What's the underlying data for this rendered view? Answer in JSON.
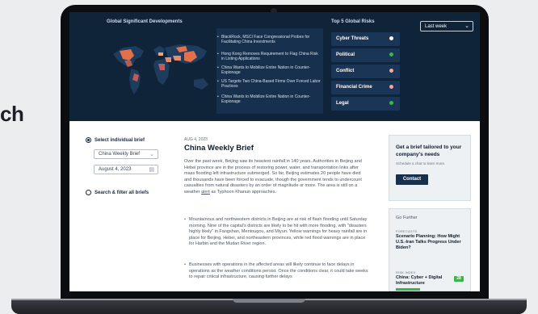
{
  "background_text": "ch",
  "header": {
    "developments_title": "Global Significant Developments",
    "risks_title": "Top 5 Global Risks",
    "period_select": "Last week"
  },
  "news": [
    "BlackRock, MSCI Face Congressional Probes for Facilitating China Investments",
    "Hong Kong Removes Requirement to Flag China Risk in Listing Applications",
    "China Wants to Mobilize Entire Nation in Counter-Espionage",
    "US Targets Two China-Based Firms Over Forced Labor Practices",
    "China Wants to Mobilize Entire Nation in Counter-Espionage"
  ],
  "risks": [
    {
      "label": "Cyber Threats",
      "icon": "plus-icon",
      "color": "#ffffff"
    },
    {
      "label": "Political",
      "icon": "plus-icon",
      "color": "#3bb54a"
    },
    {
      "label": "Conflict",
      "icon": "plus-icon",
      "color": "#f4a6a6"
    },
    {
      "label": "Financial Crime",
      "icon": "plus-icon",
      "color": "#f4a6a6"
    },
    {
      "label": "Legal",
      "icon": "plus-icon",
      "color": "#3bb54a"
    }
  ],
  "filters": {
    "select_individual_label": "Select individual brief",
    "brief_select": "China Weekly Brief",
    "date_field": "August 4, 2023",
    "search_filter_label": "Search & filter all briefs"
  },
  "article": {
    "date": "AUG 4, 2023",
    "title": "China Weekly Brief",
    "paragraph_before": "Over the past week, Beijing saw its heaviest rainfall in 140 years. Authorities in Beijing and Hebei province are in the process of restoring power, water, and transportation links after mass flooding left infrastructure submerged. So far, Beijing estimates 20 people have died and thousands have been forced to evacuate, though the government tends to undercount casualties from natural disasters by an order of magnitude or more. The area is still on a weather ",
    "paragraph_link": "alert",
    "paragraph_after": " as Typhoon Khanun approaches.",
    "bullet1": "Mountainous and northwestern districts in Beijing are at risk of flash flooding until Saturday morning. Nine of the capital's districts are likely to be hit with more flooding, with \"disasters highly likely\" in Fangshan, Mentougou, and Miyun. Yellow warnings for heavy rainfall are in place for Beijing, Hebei, and northeastern provinces, while red flood warnings are in place for Harbin and the Mudan River region.",
    "bullet2": "Businesses with operations in the affected areas will likely continue to face delays in operations as the weather conditions persist. Once the conditions clear, it could take weeks to repair critical infrastructure, causing further delays"
  },
  "cta": {
    "title": "Get a brief tailored to your company's needs",
    "subtitle": "Schedule a chat to learn more.",
    "button": "Contact"
  },
  "go_further": {
    "title": "Go Further",
    "items": [
      {
        "category": "FORECASTS",
        "title": "Scenario Planning: How Might U.S.-Iran Talks Progress Under Biden?"
      },
      {
        "category": "RISK INDEX",
        "title": "China: Cyber + Digital Infrastructure",
        "badge": "28"
      }
    ]
  }
}
